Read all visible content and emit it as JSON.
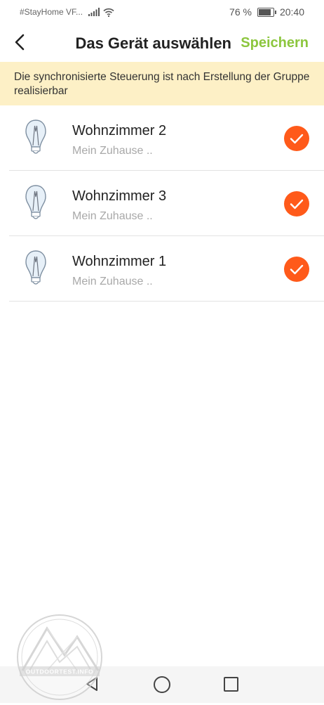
{
  "status_bar": {
    "carrier": "#StayHome VF...",
    "battery_percent": "76 %",
    "battery_level": 0.76,
    "time": "20:40"
  },
  "header": {
    "title": "Das Gerät auswählen",
    "save_label": "Speichern",
    "accent_color": "#8cc63e"
  },
  "notice": {
    "text": "Die synchronisierte Steuerung ist nach Erstellung der Gruppe realisierbar"
  },
  "devices": [
    {
      "name": "Wohnzimmer 2",
      "location": "Mein Zuhause ..",
      "selected": true,
      "icon": "light-bulb-icon"
    },
    {
      "name": "Wohnzimmer 3",
      "location": "Mein Zuhause ..",
      "selected": true,
      "icon": "light-bulb-icon"
    },
    {
      "name": "Wohnzimmer 1",
      "location": "Mein Zuhause ..",
      "selected": true,
      "icon": "light-bulb-icon"
    }
  ],
  "check_color": "#ff5a1a",
  "watermark": {
    "text": "OUTDOORTEST.INFO"
  }
}
